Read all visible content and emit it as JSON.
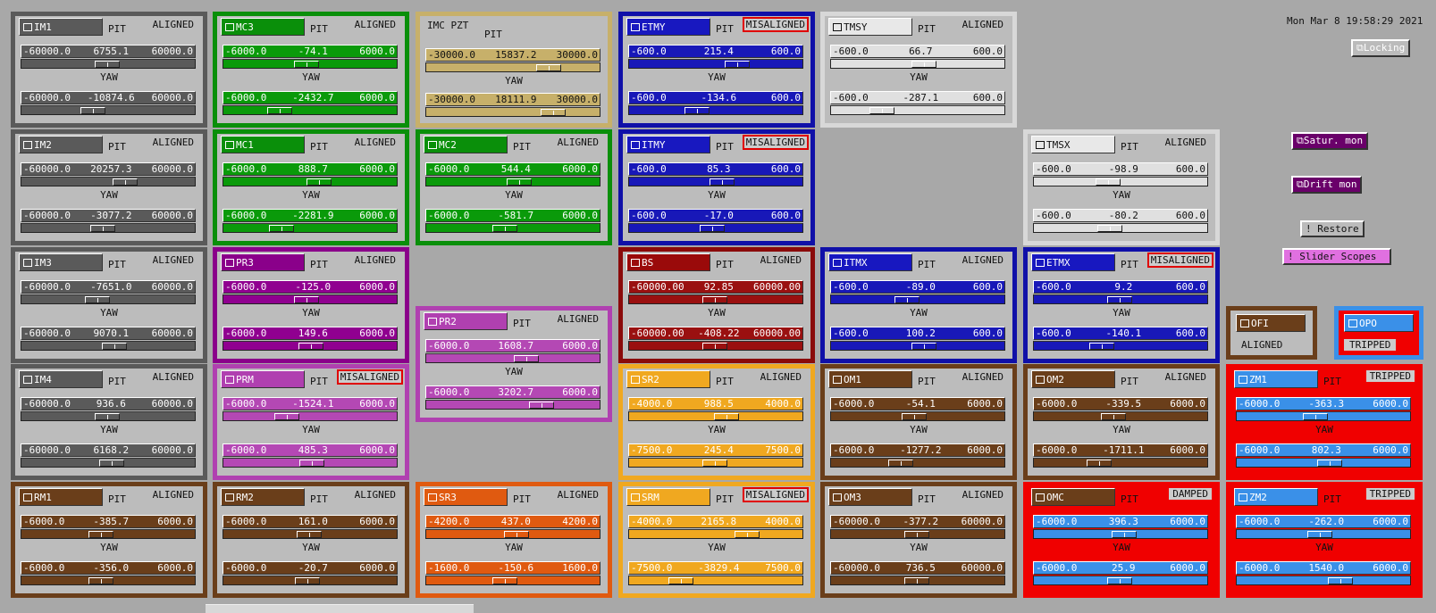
{
  "clock": "Mon Mar  8 19:58:29 2021",
  "buttons": {
    "locking": "Locking",
    "satur": "Satur. mon",
    "drift": "Drift mon",
    "restore": "! Restore",
    "slider_scopes": "! Slider Scopes"
  },
  "labels": {
    "pit": "PIT",
    "yaw": "YAW"
  },
  "colors": {
    "gray": "#5a5a5a",
    "green": "#0a8f0a",
    "tan": "#c7b06a",
    "blue": "#1010a8",
    "light": "#d8d8d8",
    "purple": "#8a008a",
    "magenta": "#b040b0",
    "darkred": "#8a0a0a",
    "orange": "#f0a820",
    "darkorange": "#e05a10",
    "brown": "#6a3e1a",
    "skyblue": "#3a90e8",
    "red": "#f00000"
  },
  "cells": [
    {
      "id": "IM1",
      "status": "ALIGNED",
      "style": "gray",
      "p": [
        "-60000.0",
        "6755.1",
        "60000.0"
      ],
      "y": [
        "-60000.0",
        "-10874.6",
        "60000.0"
      ],
      "pk": 0.5,
      "yk": 0.4
    },
    {
      "id": "MC3",
      "status": "ALIGNED",
      "style": "green",
      "p": [
        "-6000.0",
        "-74.1",
        "6000.0"
      ],
      "y": [
        "-6000.0",
        "-2432.7",
        "6000.0"
      ],
      "pk": 0.48,
      "yk": 0.3
    },
    {
      "id": "IMC PZT",
      "status": "",
      "style": "tan",
      "p": [
        "-30000.0",
        "15837.2",
        "30000.0"
      ],
      "y": [
        "-30000.0",
        "18111.9",
        "30000.0"
      ],
      "pk": 0.75,
      "yk": 0.78
    },
    {
      "id": "ETMY",
      "status": "MISALIGNED",
      "style": "blue",
      "p": [
        "-600.0",
        "215.4",
        "600.0"
      ],
      "y": [
        "-600.0",
        "-134.6",
        "600.0"
      ],
      "pk": 0.65,
      "yk": 0.38
    },
    {
      "id": "TMSY",
      "status": "ALIGNED",
      "style": "light",
      "p": [
        "-600.0",
        "66.7",
        "600.0"
      ],
      "y": [
        "-600.0",
        "-287.1",
        "600.0"
      ],
      "pk": 0.55,
      "yk": 0.26
    },
    {
      "id": "IM2",
      "status": "ALIGNED",
      "style": "gray",
      "p": [
        "-60000.0",
        "20257.3",
        "60000.0"
      ],
      "y": [
        "-60000.0",
        "-3077.2",
        "60000.0"
      ],
      "pk": 0.62,
      "yk": 0.47
    },
    {
      "id": "MC1",
      "status": "ALIGNED",
      "style": "green",
      "p": [
        "-6000.0",
        "888.7",
        "6000.0"
      ],
      "y": [
        "-6000.0",
        "-2281.9",
        "6000.0"
      ],
      "pk": 0.57,
      "yk": 0.31
    },
    {
      "id": "MC2",
      "status": "ALIGNED",
      "style": "green",
      "p": [
        "-6000.0",
        "544.4",
        "6000.0"
      ],
      "y": [
        "-6000.0",
        "-581.7",
        "6000.0"
      ],
      "pk": 0.55,
      "yk": 0.45
    },
    {
      "id": "ITMY",
      "status": "MISALIGNED",
      "style": "blue",
      "p": [
        "-600.0",
        "85.3",
        "600.0"
      ],
      "y": [
        "-600.0",
        "-17.0",
        "600.0"
      ],
      "pk": 0.55,
      "yk": 0.48
    },
    {
      "id": "TMSX",
      "status": "ALIGNED",
      "style": "light",
      "p": [
        "-600.0",
        "-98.9",
        "600.0"
      ],
      "y": [
        "-600.0",
        "-80.2",
        "600.0"
      ],
      "pk": 0.42,
      "yk": 0.43
    },
    {
      "id": "IM3",
      "status": "ALIGNED",
      "style": "gray",
      "p": [
        "-60000.0",
        "-7651.0",
        "60000.0"
      ],
      "y": [
        "-60000.0",
        "9070.1",
        "60000.0"
      ],
      "pk": 0.43,
      "yk": 0.55
    },
    {
      "id": "PR3",
      "status": "ALIGNED",
      "style": "purple",
      "p": [
        "-6000.0",
        "-125.0",
        "6000.0"
      ],
      "y": [
        "-6000.0",
        "149.6",
        "6000.0"
      ],
      "pk": 0.48,
      "yk": 0.51
    },
    {
      "id": "BS",
      "status": "ALIGNED",
      "style": "darkred",
      "p": [
        "-60000.00",
        "92.85",
        "60000.00"
      ],
      "y": [
        "-60000.00",
        "-408.22",
        "60000.00"
      ],
      "pk": 0.5,
      "yk": 0.5
    },
    {
      "id": "ITMX",
      "status": "ALIGNED",
      "style": "blue",
      "p": [
        "-600.0",
        "-89.0",
        "600.0"
      ],
      "y": [
        "-600.0",
        "100.2",
        "600.0"
      ],
      "pk": 0.43,
      "yk": 0.55
    },
    {
      "id": "ETMX",
      "status": "MISALIGNED",
      "style": "blue",
      "p": [
        "-600.0",
        "9.2",
        "600.0"
      ],
      "y": [
        "-600.0",
        "-140.1",
        "600.0"
      ],
      "pk": 0.5,
      "yk": 0.38
    },
    {
      "id": "PR2",
      "status": "ALIGNED",
      "style": "magenta",
      "p": [
        "-6000.0",
        "1608.7",
        "6000.0"
      ],
      "y": [
        "-6000.0",
        "3202.7",
        "6000.0"
      ],
      "pk": 0.6,
      "yk": 0.7
    },
    {
      "id": "IM4",
      "status": "ALIGNED",
      "style": "gray",
      "p": [
        "-60000.0",
        "936.6",
        "60000.0"
      ],
      "y": [
        "-60000.0",
        "6168.2",
        "60000.0"
      ],
      "pk": 0.5,
      "yk": 0.53
    },
    {
      "id": "PRM",
      "status": "MISALIGNED",
      "style": "magenta",
      "p": [
        "-6000.0",
        "-1524.1",
        "6000.0"
      ],
      "y": [
        "-6000.0",
        "485.3",
        "6000.0"
      ],
      "pk": 0.35,
      "yk": 0.52
    },
    {
      "id": "SR2",
      "status": "ALIGNED",
      "style": "orange",
      "p": [
        "-4000.0",
        "988.5",
        "4000.0"
      ],
      "y": [
        "-7500.0",
        "245.4",
        "7500.0"
      ],
      "pk": 0.58,
      "yk": 0.5
    },
    {
      "id": "OM1",
      "status": "ALIGNED",
      "style": "brown",
      "p": [
        "-6000.0",
        "-54.1",
        "6000.0"
      ],
      "y": [
        "-6000.0",
        "-1277.2",
        "6000.0"
      ],
      "pk": 0.48,
      "yk": 0.39
    },
    {
      "id": "OM2",
      "status": "ALIGNED",
      "style": "brown",
      "p": [
        "-6000.0",
        "-339.5",
        "6000.0"
      ],
      "y": [
        "-6000.0",
        "-1711.1",
        "6000.0"
      ],
      "pk": 0.46,
      "yk": 0.36
    },
    {
      "id": "ZM1",
      "status": "TRIPPED",
      "style": "red",
      "p": [
        "-6000.0",
        "-363.3",
        "6000.0"
      ],
      "y": [
        "-6000.0",
        "802.3",
        "6000.0"
      ],
      "pk": 0.45,
      "yk": 0.55
    },
    {
      "id": "RM1",
      "status": "ALIGNED",
      "style": "brown",
      "p": [
        "-6000.0",
        "-385.7",
        "6000.0"
      ],
      "y": [
        "-6000.0",
        "-356.0",
        "6000.0"
      ],
      "pk": 0.46,
      "yk": 0.46
    },
    {
      "id": "RM2",
      "status": "ALIGNED",
      "style": "brown",
      "p": [
        "-6000.0",
        "161.0",
        "6000.0"
      ],
      "y": [
        "-6000.0",
        "-20.7",
        "6000.0"
      ],
      "pk": 0.5,
      "yk": 0.49
    },
    {
      "id": "SR3",
      "status": "ALIGNED",
      "style": "darkorange",
      "p": [
        "-4200.0",
        "437.0",
        "4200.0"
      ],
      "y": [
        "-1600.0",
        "-150.6",
        "1600.0"
      ],
      "pk": 0.53,
      "yk": 0.45
    },
    {
      "id": "SRM",
      "status": "MISALIGNED",
      "style": "orange",
      "p": [
        "-4000.0",
        "2165.8",
        "4000.0"
      ],
      "y": [
        "-7500.0",
        "-3829.4",
        "7500.0"
      ],
      "pk": 0.72,
      "yk": 0.27
    },
    {
      "id": "OM3",
      "status": "ALIGNED",
      "style": "brown",
      "p": [
        "-60000.0",
        "-377.2",
        "60000.0"
      ],
      "y": [
        "-60000.0",
        "736.5",
        "60000.0"
      ],
      "pk": 0.5,
      "yk": 0.5
    },
    {
      "id": "OMC",
      "status": "DAMPED",
      "style": "red",
      "p": [
        "-6000.0",
        "396.3",
        "6000.0"
      ],
      "y": [
        "-6000.0",
        "25.9",
        "6000.0"
      ],
      "pk": 0.53,
      "yk": 0.5
    },
    {
      "id": "ZM2",
      "status": "TRIPPED",
      "style": "red",
      "p": [
        "-6000.0",
        "-262.0",
        "6000.0"
      ],
      "y": [
        "-6000.0",
        "1540.0",
        "6000.0"
      ],
      "pk": 0.48,
      "yk": 0.62
    }
  ],
  "mini": [
    {
      "id": "OFI",
      "status": "ALIGNED"
    },
    {
      "id": "OPO",
      "status": "TRIPPED"
    }
  ]
}
